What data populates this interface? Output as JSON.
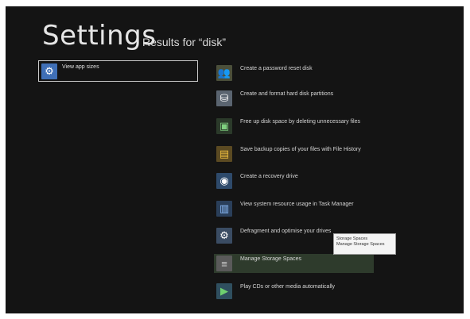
{
  "header": {
    "title": "Settings",
    "subtitle": "Results for “disk”"
  },
  "left_results": [
    {
      "label": "View app sizes",
      "icon": "gear-icon"
    }
  ],
  "right_results": [
    {
      "label": "Create a password reset disk",
      "icon": "people-icon"
    },
    {
      "label": "Create and format hard disk partitions",
      "icon": "disk-management-icon"
    },
    {
      "label": "Free up disk space by deleting unnecessary files",
      "icon": "disk-cleanup-icon"
    },
    {
      "label": "Save backup copies of your files with File History",
      "icon": "file-history-icon"
    },
    {
      "label": "Create a recovery drive",
      "icon": "recovery-drive-icon"
    },
    {
      "label": "View system resource usage in Task Manager",
      "icon": "task-manager-icon"
    },
    {
      "label": "Defragment and optimise your drives",
      "icon": "defragment-icon"
    },
    {
      "label": "Manage Storage Spaces",
      "icon": "storage-spaces-icon",
      "selected": true
    },
    {
      "label": "Play CDs or other media automatically",
      "icon": "autoplay-icon"
    }
  ],
  "tooltip": {
    "line1": "Storage Spaces",
    "line2": "Manage Storage Spaces"
  },
  "colors": {
    "background": "#141414",
    "text": "#d6d6d6",
    "selected_highlight": "#2e3b2c",
    "gear_tile": "#3f6fb6"
  }
}
